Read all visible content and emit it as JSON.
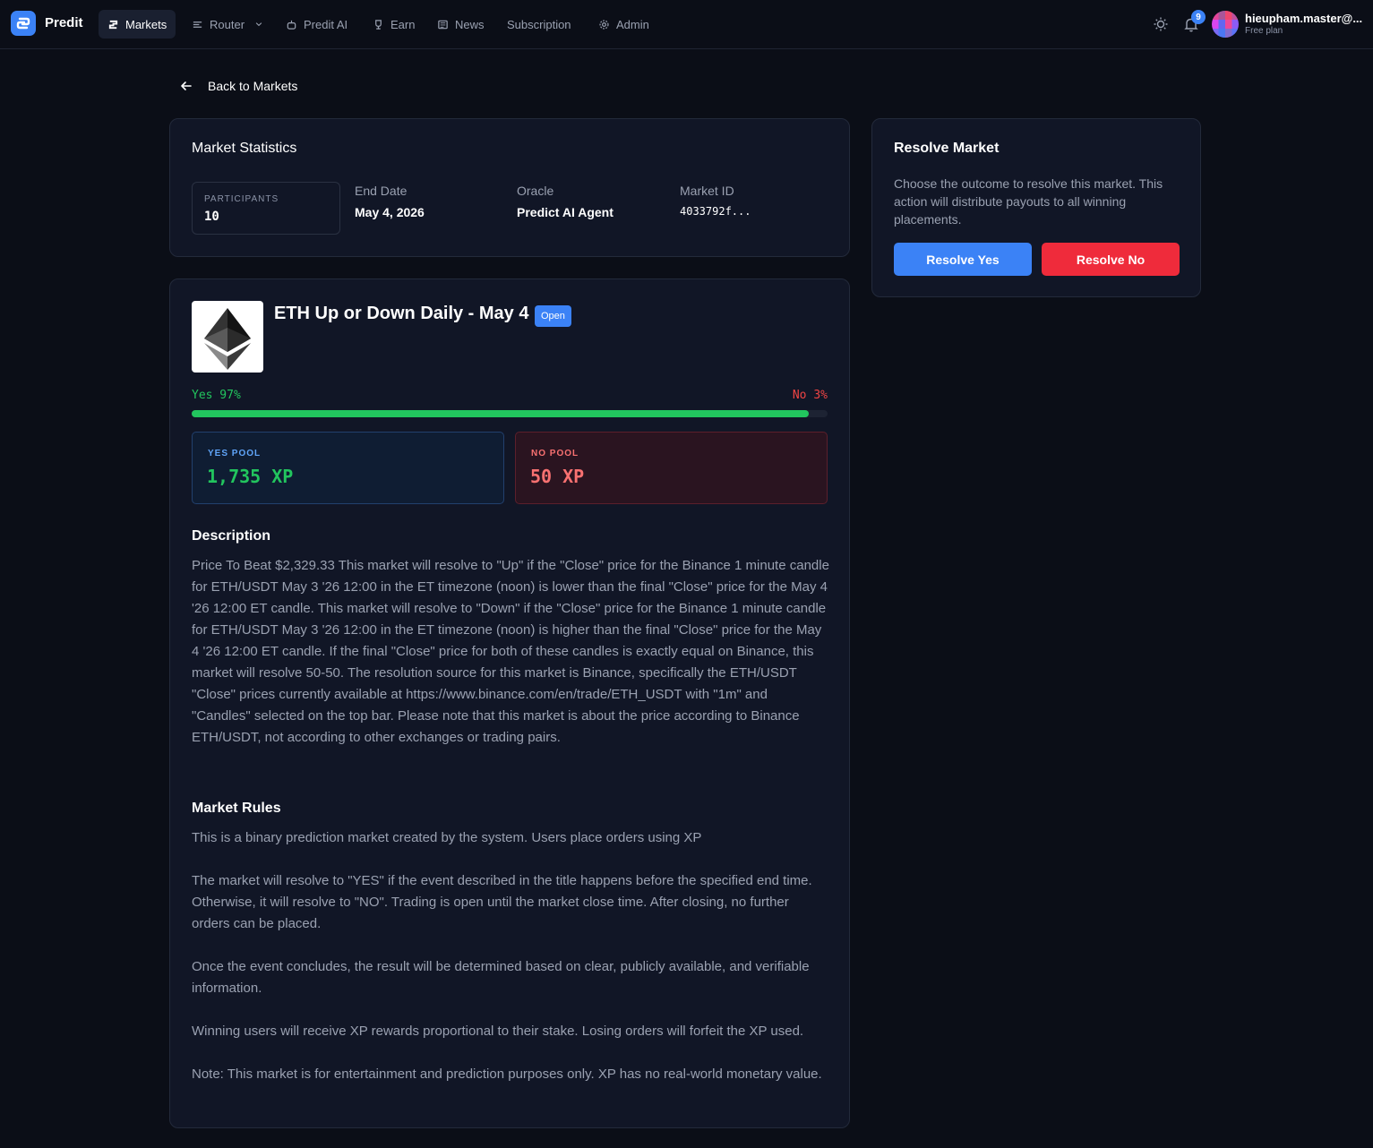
{
  "nav": {
    "brand": "Predit",
    "items": [
      {
        "label": "Markets",
        "icon": "markets-icon"
      },
      {
        "label": "Router",
        "icon": "router-icon"
      },
      {
        "label": "Predit AI",
        "icon": "ai-icon"
      },
      {
        "label": "Earn",
        "icon": "trophy-icon"
      },
      {
        "label": "News",
        "icon": "newspaper-icon"
      },
      {
        "label": "Subscription",
        "icon": ""
      },
      {
        "label": "Admin",
        "icon": "gear-icon"
      }
    ],
    "notification_count": "9",
    "user_name": "hieupham.master@...",
    "user_plan": "Free plan"
  },
  "back_label": "Back to Markets",
  "stats": {
    "title": "Market Statistics",
    "participants_label": "PARTICIPANTS",
    "participants_value": "10",
    "end_date_label": "End Date",
    "end_date_value": "May 4, 2026",
    "oracle_label": "Oracle",
    "oracle_value": "Predict AI Agent",
    "market_id_label": "Market ID",
    "market_id_value": "4033792f..."
  },
  "resolve": {
    "title": "Resolve Market",
    "description": "Choose the outcome to resolve this market. This action will distribute payouts to all winning placements.",
    "yes_label": "Resolve Yes",
    "no_label": "Resolve No"
  },
  "market": {
    "title": "ETH Up or Down Daily - May 4",
    "status": "Open",
    "yes_text": "Yes 97%",
    "no_text": "No 3%",
    "yes_fraction": 0.97,
    "yes_pool_label": "YES POOL",
    "yes_pool_value": "1,735 XP",
    "no_pool_label": "NO POOL",
    "no_pool_value": "50 XP",
    "description_heading": "Description",
    "description": "Price To Beat $2,329.33 This market will resolve to \"Up\" if the \"Close\" price for the Binance 1 minute candle for ETH/USDT May 3 '26 12:00 in the ET timezone (noon) is lower than the final \"Close\" price for the May 4 '26 12:00 ET candle. This market will resolve to \"Down\" if the \"Close\" price for the Binance 1 minute candle for ETH/USDT May 3 '26 12:00 in the ET timezone (noon) is higher than the final \"Close\" price for the May 4 '26 12:00 ET candle. If the final \"Close\" price for both of these candles is exactly equal on Binance, this market will resolve 50-50. The resolution source for this market is Binance, specifically the ETH/USDT \"Close\" prices currently available at https://www.binance.com/en/trade/ETH_USDT with \"1m\" and \"Candles\" selected on the top bar. Please note that this market is about the price according to Binance ETH/USDT, not according to other exchanges or trading pairs.",
    "rules_heading": "Market Rules",
    "rules": [
      "This is a binary prediction market created by the system. Users place orders using XP",
      "The market will resolve to \"YES\" if the event described in the title happens before the specified end time. Otherwise, it will resolve to \"NO\". Trading is open until the market close time. After closing, no further orders can be placed.",
      "Once the event concludes, the result will be determined based on clear, publicly available, and verifiable information.",
      "Winning users will receive XP rewards proportional to their stake. Losing orders will forfeit the XP used.",
      "Note: This market is for entertainment and prediction purposes only. XP has no real-world monetary value."
    ]
  }
}
